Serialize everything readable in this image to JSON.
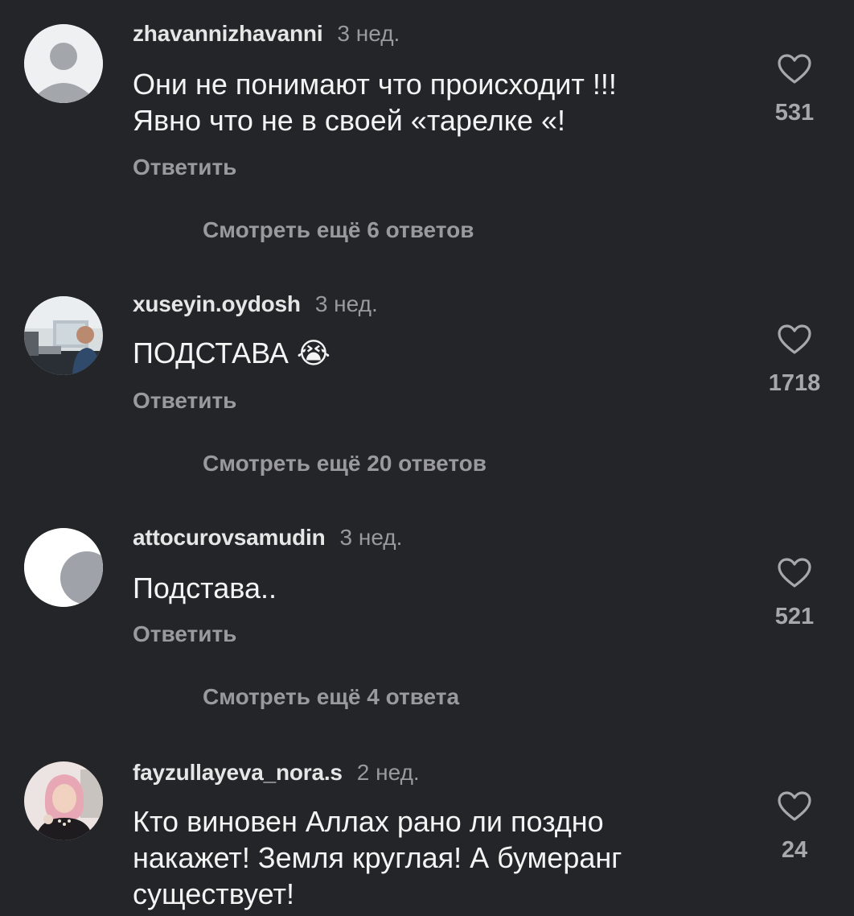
{
  "comments": [
    {
      "username": "zhavannizhavanni",
      "time": "3 нед.",
      "text_lines": [
        "Они не понимают что происходит !!!",
        "Явно что не в своей «тарелке «!"
      ],
      "reply_label": "Ответить",
      "likes": "531",
      "more_replies": "Смотреть ещё 6 ответов",
      "avatar": "default-user-avatar"
    },
    {
      "username": "xuseyin.oydosh",
      "time": "3 нед.",
      "text": "ПОДСТАВА 😭",
      "reply_label": "Ответить",
      "likes": "1718",
      "more_replies": "Смотреть ещё 20 ответов",
      "avatar": "photo-avatar"
    },
    {
      "username": "attocurovsamudin",
      "time": "3 нед.",
      "text": "Подстава..",
      "reply_label": "Ответить",
      "likes": "521",
      "more_replies": "Смотреть ещё 4 ответа",
      "avatar": "crescent-avatar"
    },
    {
      "username": "fayzullayeva_nora.s",
      "time": "2 нед.",
      "text_lines": [
        "Кто виновен Аллах рано ли поздно",
        "накажет! Земля круглая! А бумеранг",
        "существует!"
      ],
      "likes": "24",
      "avatar": "photo-avatar"
    }
  ],
  "colors": {
    "background": "#242528",
    "primary_text": "#f4f4f4",
    "secondary_text": "#9a9a9c"
  }
}
